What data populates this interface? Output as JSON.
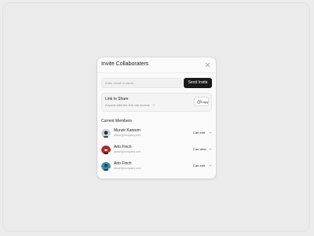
{
  "dialog": {
    "title": "Invite Collaboraters",
    "invite_input": {
      "placeholder": "Enter email or name...",
      "value": ""
    },
    "send_button_label": "Send Invite"
  },
  "share": {
    "title": "Link to Share",
    "access_label": "Anyone with the link can access",
    "copy_label": "Copy"
  },
  "members_heading": "Current Members",
  "members": [
    {
      "name": "Munzir Kareem",
      "email": "afinch@company.com",
      "role": "Can edit",
      "avatar_color": "#c9d2d6"
    },
    {
      "name": "Arlo Finch",
      "email": "afinch@company.com",
      "role": "Can view",
      "avatar_color": "#b0262b"
    },
    {
      "name": "Arlo Finch",
      "email": "afinch@company.com",
      "role": "Can edit",
      "avatar_color": "#2f8fb0"
    }
  ],
  "colors": {
    "primary_button": "#1a1a1a",
    "online_dot": "#2ecc71",
    "background": "#ebebeb"
  }
}
